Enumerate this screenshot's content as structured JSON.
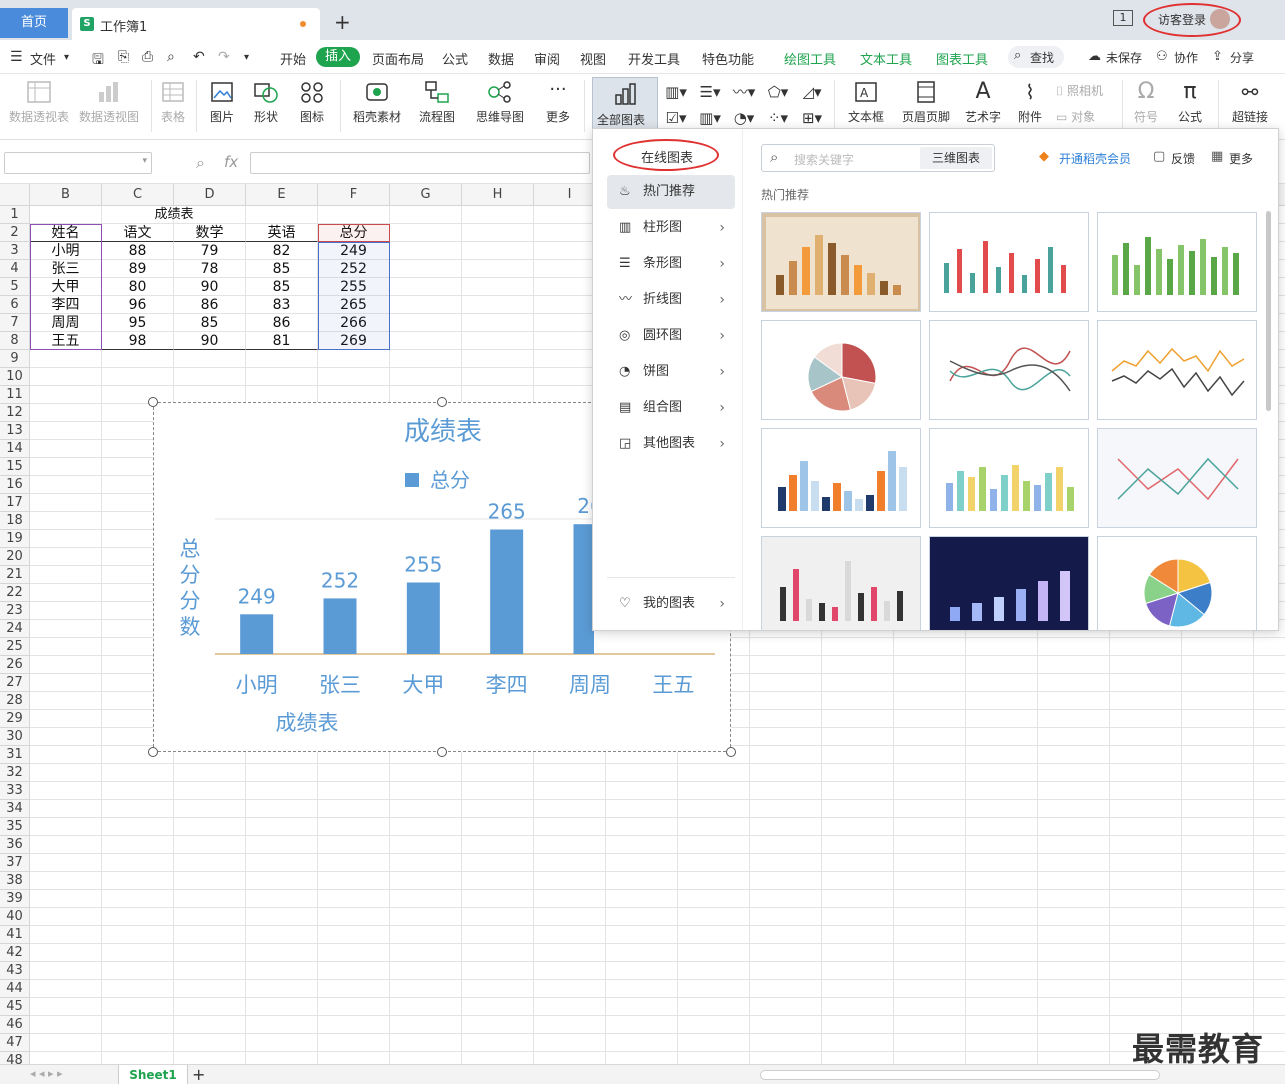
{
  "tabs": {
    "home": "首页",
    "doc_title": "工作簿1",
    "doc_icon": "S",
    "new_tab": "+"
  },
  "titlebar": {
    "window_number": "1",
    "login": "访客登录"
  },
  "menu": {
    "file": "文件",
    "items": [
      "开始",
      "插入",
      "页面布局",
      "公式",
      "数据",
      "审阅",
      "视图",
      "开发工具",
      "特色功能"
    ],
    "tools": [
      "绘图工具",
      "文本工具",
      "图表工具"
    ],
    "search": "查找",
    "unsaved": "未保存",
    "collab": "协作",
    "share": "分享"
  },
  "ribbon": {
    "pivot_table": "数据透视表",
    "pivot_chart": "数据透视图",
    "table": "表格",
    "picture": "图片",
    "shape": "形状",
    "icon": "图标",
    "material": "稻壳素材",
    "flowchart": "流程图",
    "mindmap": "思维导图",
    "more": "更多",
    "all_charts": "全部图表",
    "textbox": "文本框",
    "header_footer": "页眉页脚",
    "wordart": "艺术字",
    "attachment": "附件",
    "camera": "照相机",
    "object": "对象",
    "symbol": "符号",
    "formula": "公式",
    "hyperlink": "超链接"
  },
  "formula_bar": {
    "fx": "fx"
  },
  "columns": [
    "B",
    "C",
    "D",
    "E",
    "F",
    "G",
    "H",
    "I"
  ],
  "rows": [
    "1",
    "2",
    "3",
    "4",
    "5",
    "6",
    "7",
    "8",
    "9",
    "10",
    "11",
    "12",
    "13",
    "14",
    "15",
    "16",
    "17",
    "18",
    "19",
    "20",
    "21",
    "22",
    "23",
    "24",
    "25",
    "26",
    "27",
    "28",
    "29",
    "30",
    "31",
    "32",
    "33",
    "34",
    "35",
    "36",
    "37",
    "38",
    "39",
    "40",
    "41",
    "42",
    "43",
    "44",
    "45",
    "46",
    "47",
    "48"
  ],
  "sheet": {
    "title": "成绩表",
    "headers": [
      "姓名",
      "语文",
      "数学",
      "英语",
      "总分"
    ],
    "rows": [
      [
        "小明",
        "88",
        "79",
        "82",
        "249"
      ],
      [
        "张三",
        "89",
        "78",
        "85",
        "252"
      ],
      [
        "大甲",
        "80",
        "90",
        "85",
        "255"
      ],
      [
        "李四",
        "96",
        "86",
        "83",
        "265"
      ],
      [
        "周周",
        "95",
        "85",
        "86",
        "266"
      ],
      [
        "王五",
        "98",
        "90",
        "81",
        "269"
      ]
    ]
  },
  "chart_data": {
    "type": "bar",
    "title": "成绩表",
    "legend": "总分",
    "ylabel": "总分分数",
    "xlabel": "成绩表",
    "categories": [
      "小明",
      "张三",
      "大甲",
      "李四",
      "周周",
      "王五"
    ],
    "series": [
      {
        "name": "总分",
        "values": [
          249,
          252,
          255,
          265,
          266,
          269
        ]
      }
    ],
    "color": "#5b9bd5",
    "labels": [
      "249",
      "252",
      "255",
      "265",
      "26"
    ],
    "ylim": [
      0,
      300
    ]
  },
  "popup": {
    "online_charts": "在线图表",
    "search_placeholder": "搜索关键字",
    "three_d": "三维图表",
    "vip": "开通稻壳会员",
    "feedback": "反馈",
    "more": "更多",
    "section_title": "热门推荐",
    "sidebar": [
      "热门推荐",
      "柱形图",
      "条形图",
      "折线图",
      "圆环图",
      "饼图",
      "组合图",
      "其他图表"
    ],
    "my_charts": "我的图表"
  },
  "bottom": {
    "sheet": "Sheet1",
    "add": "+"
  },
  "watermark": "最需教育",
  "colors": {
    "accent_green": "#1ea34e",
    "home_tab": "#4a8cdb",
    "chart_blue": "#5b9bd5",
    "highlight_red": "#e03131"
  }
}
